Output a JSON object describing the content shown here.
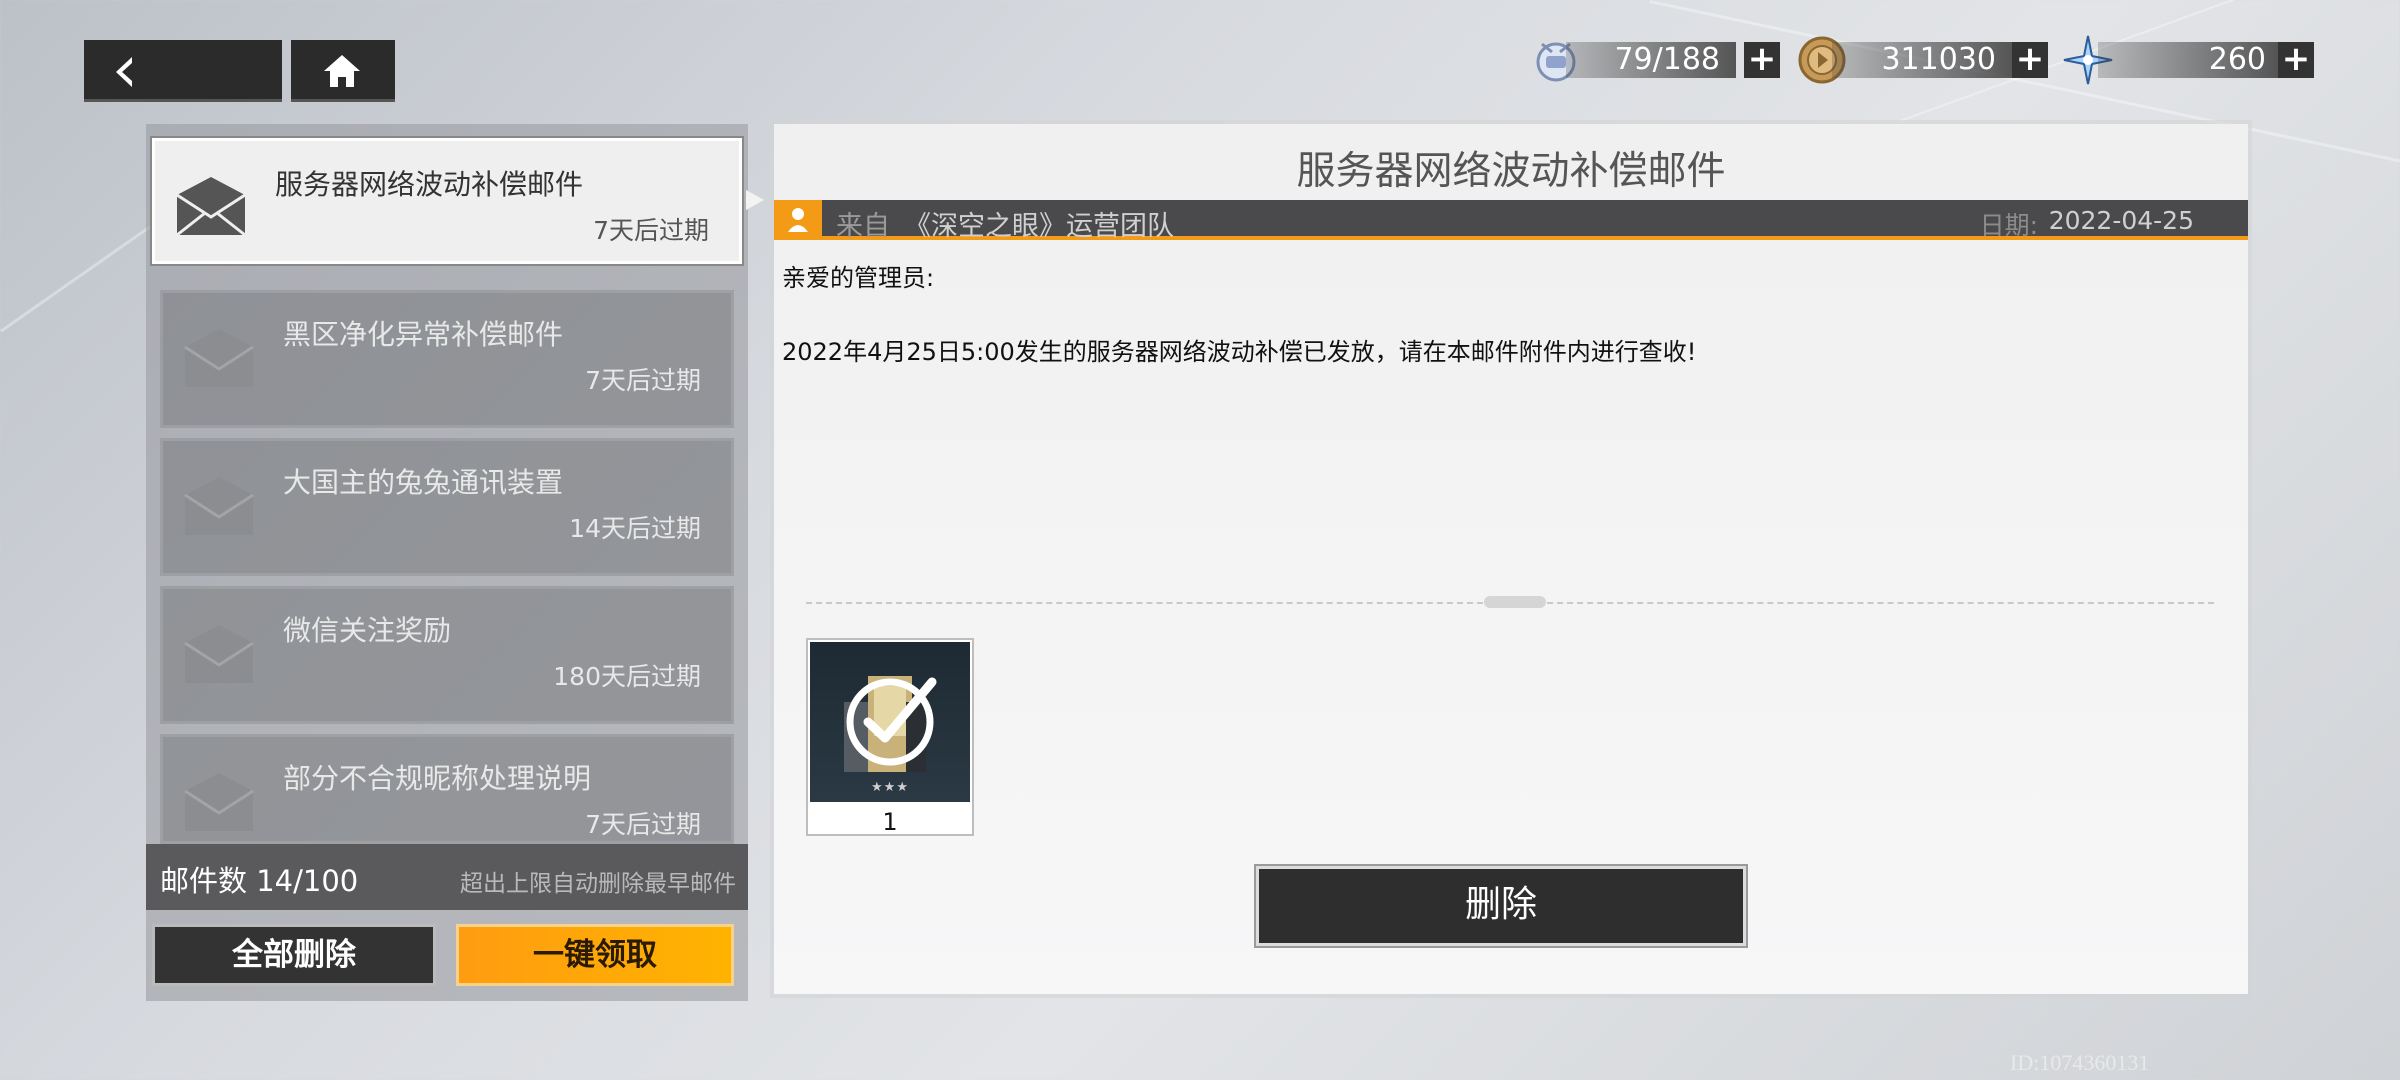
{
  "nav": {
    "back_icon": "back-arrow-icon",
    "home_icon": "home-icon"
  },
  "resources": [
    {
      "icon": "stamina-icon",
      "value": "79/188",
      "plus": "+"
    },
    {
      "icon": "coin-icon",
      "value": "311030",
      "plus": "+"
    },
    {
      "icon": "crystal-icon",
      "value": "260",
      "plus": "+"
    }
  ],
  "mail_list": {
    "items": [
      {
        "title": "服务器网络波动补偿邮件",
        "expiry": "7天后过期",
        "selected": true
      },
      {
        "title": "黑区净化异常补偿邮件",
        "expiry": "7天后过期",
        "selected": false
      },
      {
        "title": "大国主的兔兔通讯装置",
        "expiry": "14天后过期",
        "selected": false
      },
      {
        "title": "微信关注奖励",
        "expiry": "180天后过期",
        "selected": false
      },
      {
        "title": "部分不合规昵称处理说明",
        "expiry": "7天后过期",
        "selected": false
      }
    ],
    "count_label": "邮件数 14/100",
    "count_hint": "超出上限自动删除最早邮件",
    "delete_all_label": "全部删除",
    "claim_all_label": "一键领取"
  },
  "mail_detail": {
    "title": "服务器网络波动补偿邮件",
    "sender_label": "来自",
    "sender_name": "《深空之眼》运营团队",
    "date_label": "日期:",
    "date_value": "2022-04-25",
    "greeting": "亲爱的管理员:",
    "body": "2022年4月25日5:00发生的服务器网络波动补偿已发放，请在本邮件附件内进行查收!",
    "attachment": {
      "quantity": "1",
      "stars": "★★★",
      "claimed": true
    },
    "delete_label": "删除"
  },
  "uid": "ID:1074360131",
  "colors": {
    "accent": "#f39a16",
    "dark": "#2e2e2e"
  }
}
